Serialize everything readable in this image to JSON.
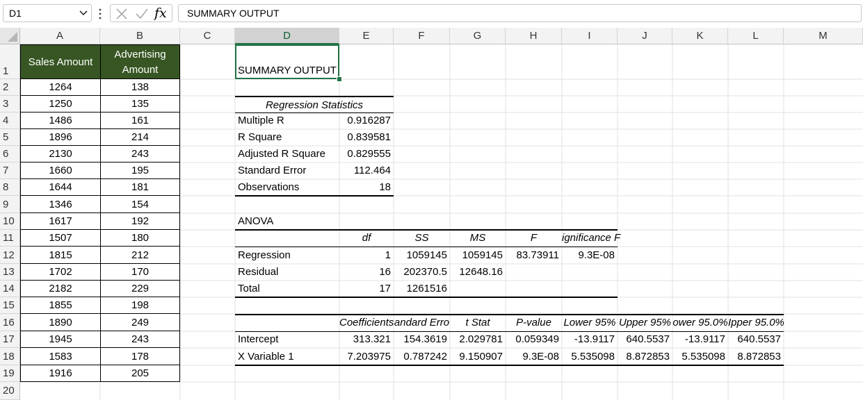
{
  "formula_bar": {
    "name_box": "D1",
    "formula": "SUMMARY OUTPUT",
    "icons": [
      "cancel-icon",
      "enter-check-icon",
      "insert-function-icon"
    ]
  },
  "columns": [
    "A",
    "B",
    "C",
    "D",
    "E",
    "F",
    "G",
    "H",
    "I",
    "J",
    "K",
    "L",
    "M"
  ],
  "selected_column": "D",
  "rows": [
    "1",
    "2",
    "3",
    "4",
    "5",
    "6",
    "7",
    "8",
    "9",
    "10",
    "11",
    "12",
    "13",
    "14",
    "15",
    "16",
    "17",
    "18",
    "19",
    "20"
  ],
  "data_table": {
    "header_a": "Sales Amount",
    "header_b": [
      "Advertising",
      "Amount"
    ],
    "header_bg": "#375623",
    "sales": [
      "1264",
      "1250",
      "1486",
      "1896",
      "2130",
      "1660",
      "1644",
      "1346",
      "1617",
      "1507",
      "1815",
      "1702",
      "2182",
      "1855",
      "1890",
      "1945",
      "1583",
      "1916"
    ],
    "advertising": [
      "138",
      "135",
      "161",
      "214",
      "243",
      "195",
      "181",
      "154",
      "192",
      "180",
      "212",
      "170",
      "229",
      "198",
      "249",
      "243",
      "178",
      "205"
    ]
  },
  "summary": {
    "title": "SUMMARY OUTPUT",
    "regression_statistics": {
      "heading": "Regression Statistics",
      "labels": [
        "Multiple R",
        "R Square",
        "Adjusted R Square",
        "Standard Error",
        "Observations"
      ],
      "values": [
        "0.916287",
        "0.839581",
        "0.829555",
        "112.464",
        "18"
      ]
    },
    "anova": {
      "title": "ANOVA",
      "headers": [
        "df",
        "SS",
        "MS",
        "F",
        "ignificance F"
      ],
      "rows": [
        {
          "label": "Regression",
          "df": "1",
          "ss": "1059145",
          "ms": "1059145",
          "f": "83.73911",
          "sig": "9.3E-08"
        },
        {
          "label": "Residual",
          "df": "16",
          "ss": "202370.5",
          "ms": "12648.16",
          "f": "",
          "sig": ""
        },
        {
          "label": "Total",
          "df": "17",
          "ss": "1261516",
          "ms": "",
          "f": "",
          "sig": ""
        }
      ]
    },
    "coefficients": {
      "headers": [
        "Coefficients",
        "andard Erro",
        "t Stat",
        "P-value",
        "Lower 95%",
        "Upper 95%",
        "ower 95.0%",
        "Ipper 95.0%"
      ],
      "rows": [
        {
          "label": "Intercept",
          "values": [
            "313.321",
            "154.3619",
            "2.029781",
            "0.059349",
            "-13.9117",
            "640.5537",
            "-13.9117",
            "640.5537"
          ]
        },
        {
          "label": "X Variable 1",
          "values": [
            "7.203975",
            "0.787242",
            "9.150907",
            "9.3E-08",
            "5.535098",
            "8.872853",
            "5.535098",
            "8.872853"
          ]
        }
      ]
    }
  }
}
